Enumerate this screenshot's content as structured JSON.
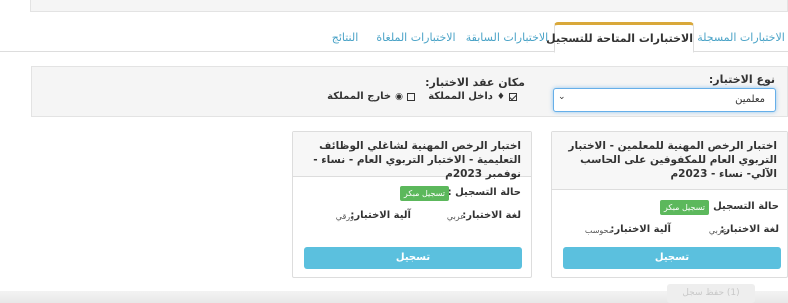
{
  "tabs": [
    {
      "label": "الاختبارات المسجلة",
      "active": false
    },
    {
      "label": "الاختبارات المتاحة للتسجيل",
      "active": true
    },
    {
      "label": "الاختبارات السابقة",
      "active": false
    },
    {
      "label": "الاختبارات الملغاة",
      "active": false
    },
    {
      "label": "النتائج",
      "active": false
    }
  ],
  "filters": {
    "test_type_label": "نوع الاختبار:",
    "test_type_value": "معلمين",
    "location_label": "مكان عقد الاختبار:",
    "inside_label": "داخل المملكة",
    "inside_checked": true,
    "outside_label": "خارج المملكة",
    "outside_checked": false
  },
  "cards": [
    {
      "title": "اختبار الرخص المهنية للمعلمين - الاختبار التربوي العام للمكفوفين على الحاسب الآلي- نساء - 2023م",
      "status_label": "حالة التسجيل :",
      "status_badge": "تسجيل مبكر",
      "language_label": "لغة الاختبار:",
      "language_value": "عربي",
      "mechanism_label": "آلية الاختبار:",
      "mechanism_value": "محوسب",
      "register_label": "تسجيل"
    },
    {
      "title": "اختبار الرخص المهنية لشاغلي الوظائف التعليمية - الاختبار التربوي العام - نساء - نوفمبر 2023م",
      "status_label": "حالة التسجيل :",
      "status_badge": "تسجيل مبكر",
      "language_label": "لغة الاختبار:",
      "language_value": "عربي",
      "mechanism_label": "آلية الاختبار:",
      "mechanism_value": "ورقي",
      "register_label": "تسجيل"
    }
  ],
  "footer_button": "(1) حفظ سجل"
}
